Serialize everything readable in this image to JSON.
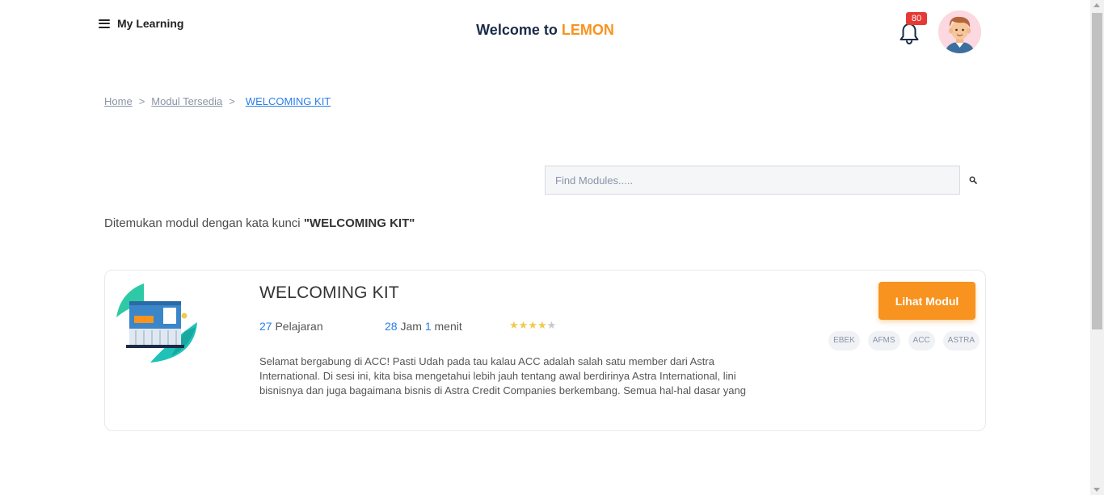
{
  "header": {
    "menu_label": "My Learning",
    "welcome_prefix": "Welcome to ",
    "brand": "LEMON",
    "notification_count": "80"
  },
  "breadcrumb": {
    "home": "Home",
    "sep1": ">",
    "modules": "Modul Tersedia",
    "sep2": ">",
    "current": "WELCOMING KIT"
  },
  "search": {
    "placeholder": "Find Modules.....",
    "value": ""
  },
  "result": {
    "prefix": "Ditemukan modul dengan kata kunci ",
    "keyword": "\"WELCOMING KIT\""
  },
  "module": {
    "title": "WELCOMING KIT",
    "lessons_count": "27",
    "lessons_label": "Pelajaran",
    "hours": "28",
    "hours_label": "Jam",
    "minutes": "1",
    "minutes_label": "menit",
    "rating": 4,
    "rating_max": 5,
    "description": "Selamat bergabung di ACC! Pasti Udah pada tau kalau ACC adalah salah satu member dari Astra International. Di sesi ini, kita bisa mengetahui lebih jauh tentang awal berdirinya Astra International, lini bisnisnya dan juga bagaimana bisnis di Astra Credit Companies berkembang. Semua hal-hal dasar yang",
    "button_label": "Lihat Modul",
    "tags": [
      "EBEK",
      "AFMS",
      "ACC",
      "ASTRA"
    ]
  },
  "colors": {
    "accent": "#f7931e",
    "link": "#2b7de9",
    "navy": "#1a2b49",
    "badge": "#e53935",
    "star_on": "#f2c94c",
    "star_off": "#c8c8c8"
  },
  "icons": {
    "menu": "hamburger-icon",
    "bell": "bell-icon",
    "search": "search-icon",
    "avatar": "user-avatar"
  }
}
